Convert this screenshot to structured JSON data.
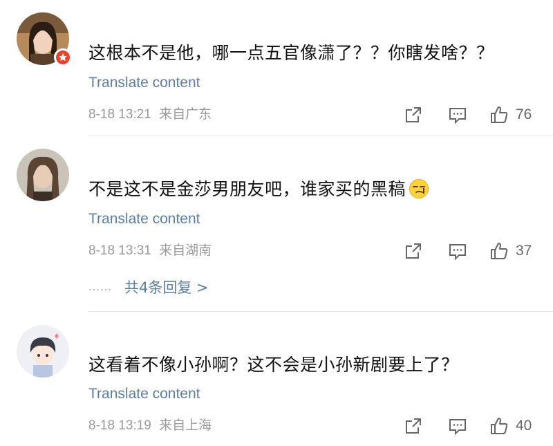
{
  "comments": [
    {
      "text": "这根本不是他，哪一点五官像潇了？？你瞎发啥？？",
      "translate_label": "Translate content",
      "time": "8-18 13:21",
      "location": "来自广东",
      "likes": "76",
      "has_badge": true
    },
    {
      "text": "不是这不是金莎男朋友吧，谁家买的黑稿",
      "translate_label": "Translate content",
      "time": "8-18 13:31",
      "location": "来自湖南",
      "likes": "37",
      "replies_dots": "……",
      "replies_label": "共4条回复 >"
    },
    {
      "text": "这看着不像小孙啊？这不会是小孙新剧要上了？",
      "translate_label": "Translate content",
      "time": "8-18 13:19",
      "location": "来自上海",
      "likes": "40"
    }
  ],
  "colors": {
    "link": "#5b7da6",
    "meta": "#999999",
    "badge": "#e6442f"
  },
  "icons": {
    "share": "share-icon",
    "comment": "comment-icon",
    "like": "thumbs-up-icon"
  }
}
